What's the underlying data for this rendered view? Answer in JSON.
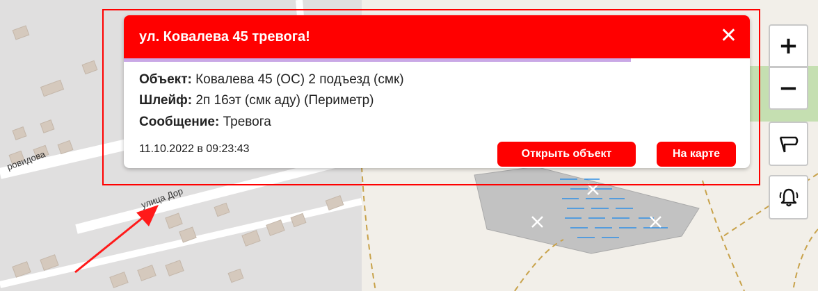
{
  "map": {
    "street_label_1": "ровидова",
    "street_label_2": "улица Дор"
  },
  "alert": {
    "title": "ул. Ковалева 45 тревога!",
    "close_glyph": "✕",
    "object_label": "Объект:",
    "object_value": "Ковалева 45 (ОС) 2 подъезд (смк)",
    "loop_label": "Шлейф:",
    "loop_value": "2п 16эт (смк аду) (Периметр)",
    "message_label": "Сообщение:",
    "message_value": "Тревога",
    "timestamp": "11.10.2022 в 09:23:43",
    "open_object_label": "Открыть объект",
    "on_map_label": "На карте",
    "progress_fraction": 0.81
  },
  "controls": {
    "zoom_in": "+",
    "zoom_out": "−",
    "flag_icon": "flag-icon",
    "bell_icon": "bell-icon"
  },
  "colors": {
    "alert_red": "#ff0000",
    "progress": "#c9a8e6",
    "water": "#2f8fe6",
    "path": "#c8a24a"
  }
}
